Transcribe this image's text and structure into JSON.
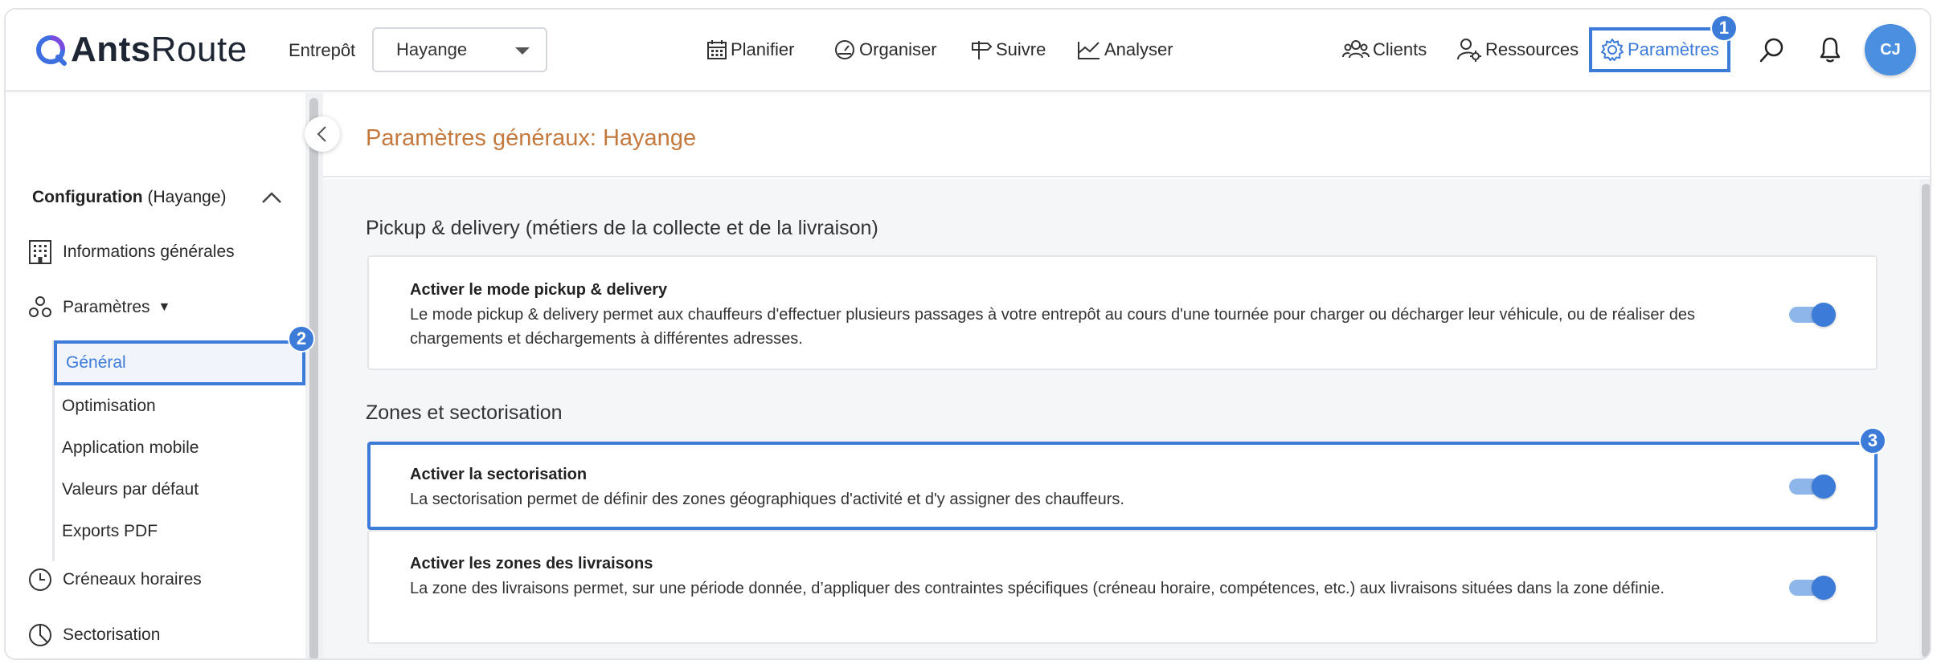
{
  "header": {
    "logo_bold": "Ants",
    "logo_light": "Route",
    "warehouse_label": "Entrepôt",
    "warehouse_value": "Hayange",
    "nav": {
      "planifier": "Planifier",
      "organiser": "Organiser",
      "suivre": "Suivre",
      "analyser": "Analyser",
      "clients": "Clients",
      "ressources": "Ressources",
      "parametres": "Paramètres"
    },
    "avatar_initials": "CJ",
    "step_badge_1": "1"
  },
  "sidebar": {
    "config_label": "Configuration",
    "config_context": "(Hayange)",
    "items": {
      "informations": "Informations générales",
      "parametres": "Paramètres",
      "parametres_caret": "▼",
      "creneaux": "Créneaux horaires",
      "sectorisation": "Sectorisation"
    },
    "sub_items": {
      "general": "Général",
      "optimisation": "Optimisation",
      "application_mobile": "Application mobile",
      "valeurs_defaut": "Valeurs par défaut",
      "exports_pdf": "Exports PDF"
    },
    "step_badge_2": "2"
  },
  "main": {
    "page_title": "Paramètres généraux: Hayange",
    "section_pickup": "Pickup & delivery (métiers de la collecte et de la livraison)",
    "section_zones": "Zones et sectorisation",
    "cards": {
      "pickup": {
        "title": "Activer le mode pickup & delivery",
        "description": "Le mode pickup & delivery permet aux chauffeurs d'effectuer plusieurs passages à votre entrepôt au cours d'une tournée pour charger ou décharger leur véhicule, ou de réaliser des chargements et déchargements à différentes adresses.",
        "enabled": true
      },
      "sectorisation": {
        "title": "Activer la sectorisation",
        "description": "La sectorisation permet de définir des zones géographiques d'activité et d'y assigner des chauffeurs.",
        "enabled": true
      },
      "zones": {
        "title": "Activer les zones des livraisons",
        "description": "La zone des livraisons permet, sur une période donnée, d’appliquer des contraintes spécifiques (créneau horaire, compétences, etc.) aux livraisons situées dans la zone définie.",
        "enabled": true
      }
    },
    "step_badge_3": "3"
  },
  "colors": {
    "accent": "#3d7bd9",
    "title_orange": "#c47a3f",
    "toggle_track": "#8fb6ea"
  }
}
